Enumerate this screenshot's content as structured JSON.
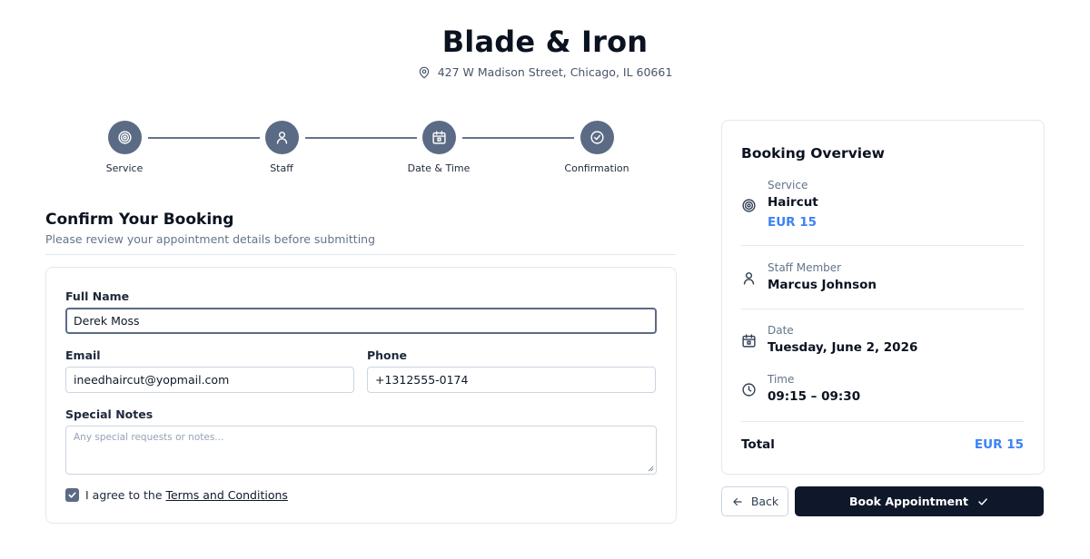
{
  "header": {
    "shop_name": "Blade & Iron",
    "address": "427 W Madison Street, Chicago, IL 60661"
  },
  "stepper": {
    "steps": [
      {
        "label": "Service",
        "icon": "target-icon"
      },
      {
        "label": "Staff",
        "icon": "user-icon"
      },
      {
        "label": "Date & Time",
        "icon": "calendar-icon"
      },
      {
        "label": "Confirmation",
        "icon": "check-circle-icon"
      }
    ]
  },
  "confirm": {
    "title": "Confirm Your Booking",
    "subtitle": "Please review your appointment details before submitting"
  },
  "form": {
    "full_name_label": "Full Name",
    "full_name_value": "Derek Moss",
    "email_label": "Email",
    "email_value": "ineedhaircut@yopmail.com",
    "phone_label": "Phone",
    "phone_value": "+1312555-0174",
    "notes_label": "Special Notes",
    "notes_placeholder": "Any special requests or notes...",
    "agree_prefix": "I agree to the ",
    "terms_link": "Terms and Conditions",
    "agree_checked": true
  },
  "overview": {
    "title": "Booking Overview",
    "service_label": "Service",
    "service_value": "Haircut",
    "service_price": "EUR 15",
    "staff_label": "Staff Member",
    "staff_value": "Marcus Johnson",
    "date_label": "Date",
    "date_value": "Tuesday, June 2, 2026",
    "time_label": "Time",
    "time_value": "09:15 – 09:30",
    "total_label": "Total",
    "total_value": "EUR 15"
  },
  "actions": {
    "back_label": "Back",
    "book_label": "Book Appointment"
  },
  "colors": {
    "accent": "#5b6b85",
    "price": "#3b82f6",
    "primary_button": "#0f172a"
  }
}
